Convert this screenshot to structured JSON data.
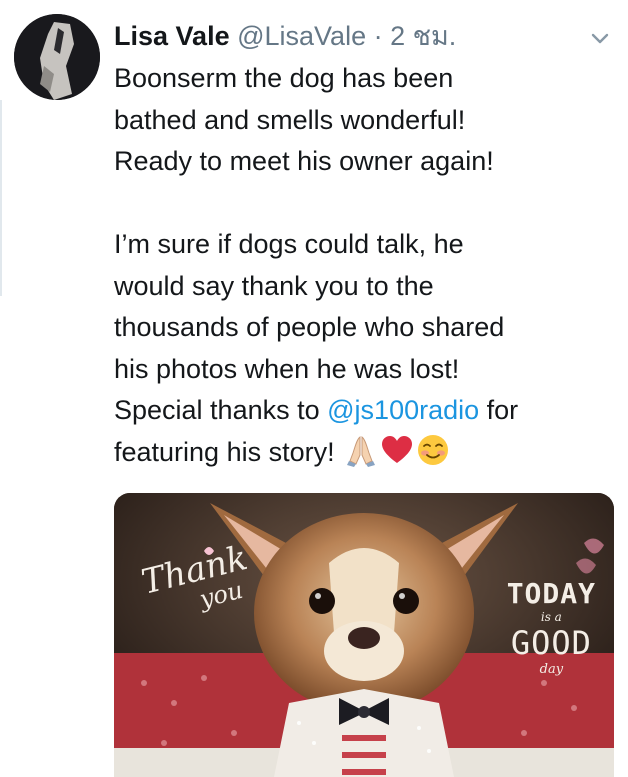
{
  "tweet": {
    "author_name": "Lisa Vale",
    "author_handle": "@LisaVale",
    "separator": "·",
    "timestamp": "2 ชม.",
    "paragraph1": [
      "Boonserm the dog has been",
      "bathed and smells wonderful!",
      "Ready to meet his owner again!"
    ],
    "paragraph2": {
      "lines": [
        "I’m sure if dogs could talk, he",
        "would say thank you to the",
        "thousands of people who shared",
        "his photos when he was lost!"
      ],
      "special_prefix": "Special thanks to ",
      "mention": "@js100radio",
      "special_suffix": " for",
      "last_line": "featuring his story! "
    },
    "emojis": [
      "folded-hands-icon",
      "red-heart-icon",
      "smiling-face-icon"
    ],
    "colors": {
      "link": "#1b95e0",
      "muted": "#657786",
      "text": "#14171a"
    }
  },
  "media": {
    "overlay_left_line1": "Thank",
    "overlay_left_line2": "you",
    "overlay_right_today": "TODAY",
    "overlay_right_isa": "is a",
    "overlay_right_good": "GOOD",
    "overlay_right_day": "day"
  }
}
